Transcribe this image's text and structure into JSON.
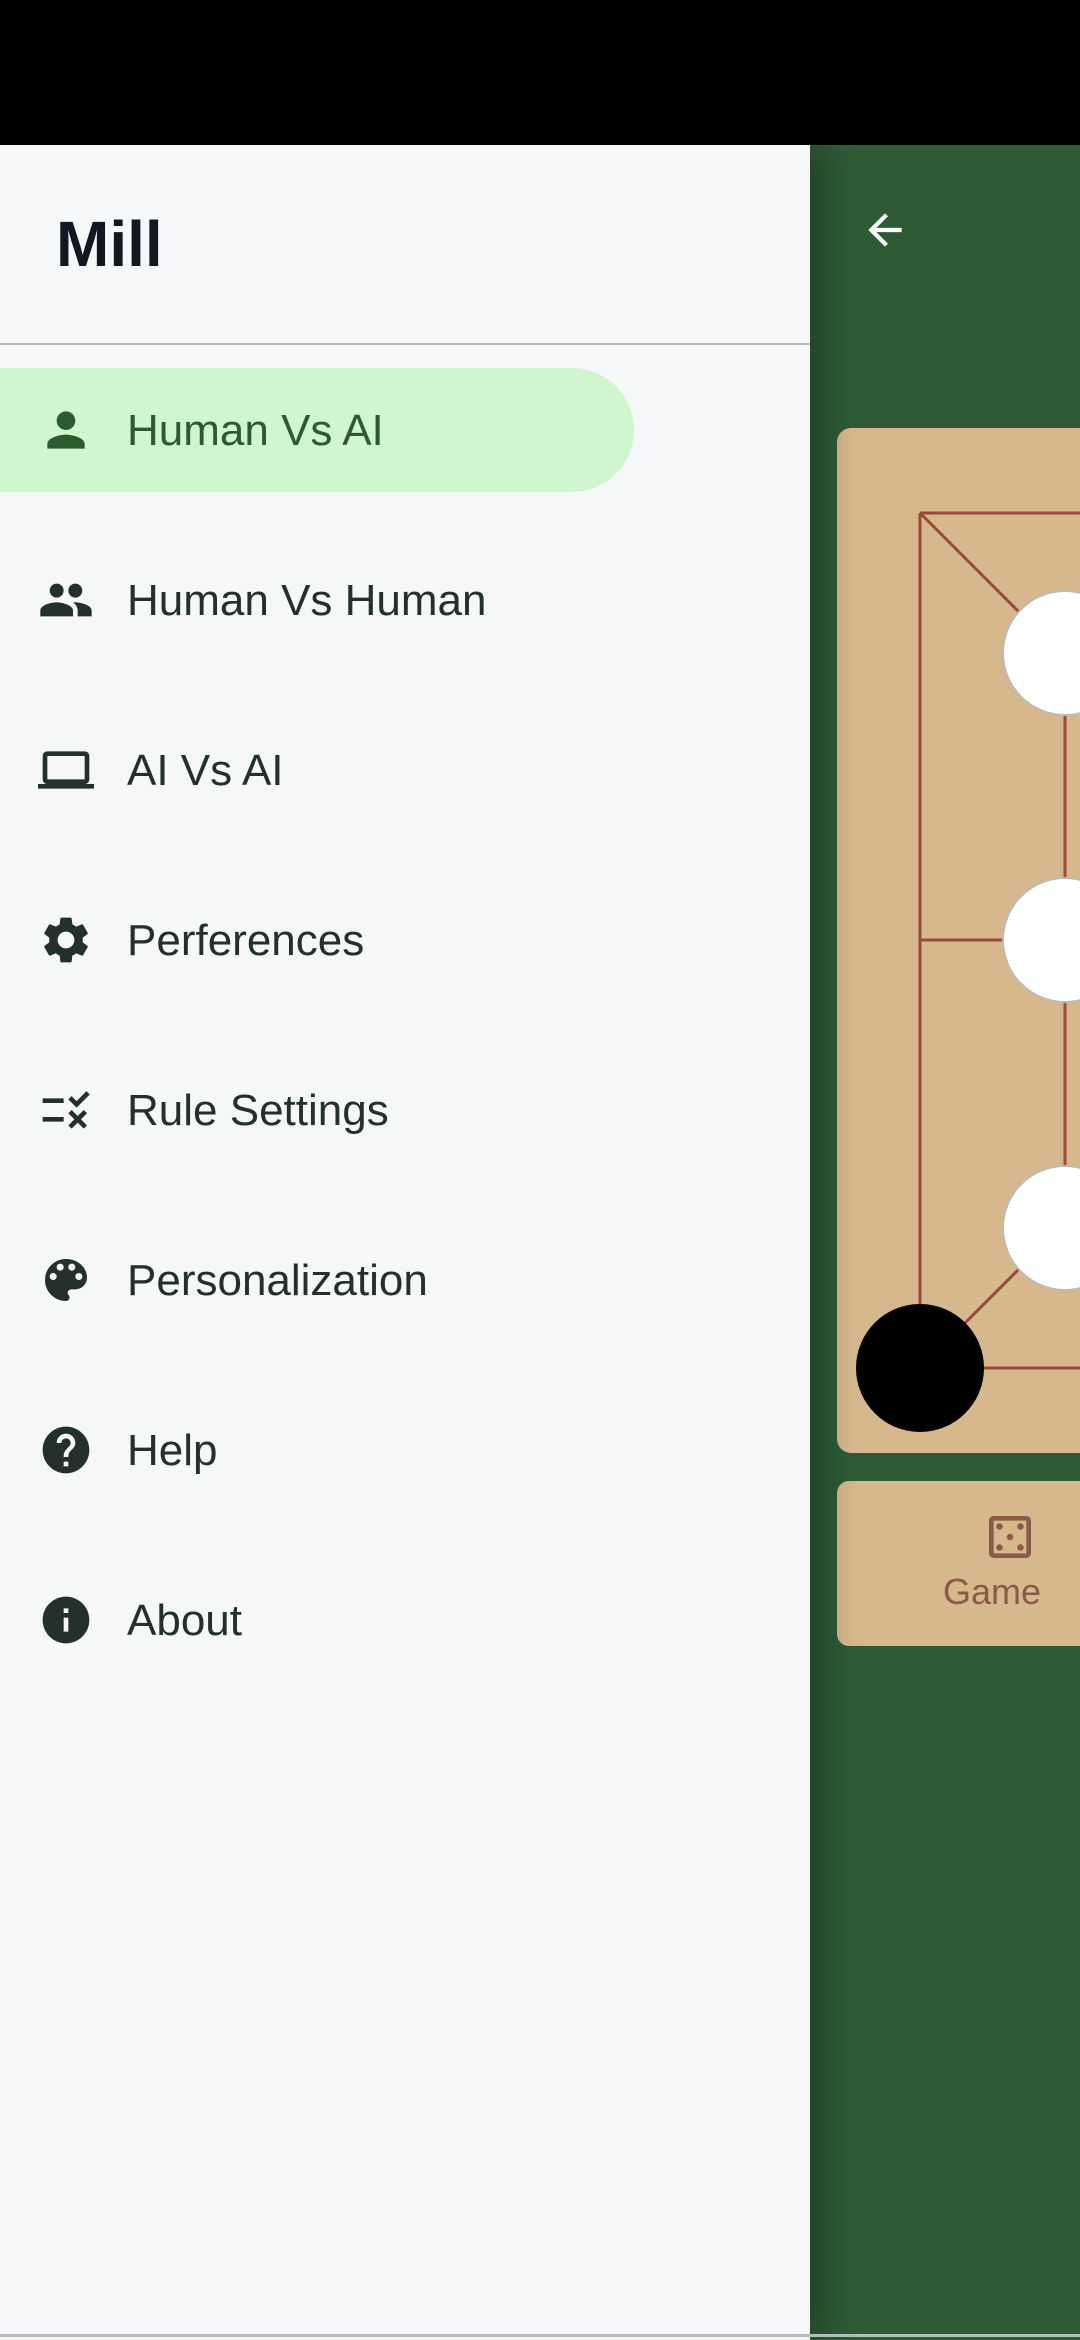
{
  "drawer": {
    "title": "Mill",
    "items": [
      {
        "label": "Human Vs AI",
        "icon": "person-icon",
        "active": true
      },
      {
        "label": "Human Vs Human",
        "icon": "people-icon",
        "active": false
      },
      {
        "label": "AI Vs AI",
        "icon": "laptop-icon",
        "active": false
      },
      {
        "label": "Perferences",
        "icon": "gear-icon",
        "active": false
      },
      {
        "label": "Rule Settings",
        "icon": "rule-icon",
        "active": false
      },
      {
        "label": "Personalization",
        "icon": "palette-icon",
        "active": false
      },
      {
        "label": "Help",
        "icon": "help-icon",
        "active": false
      },
      {
        "label": "About",
        "icon": "info-icon",
        "active": false
      }
    ]
  },
  "game": {
    "back_icon": "arrow-back-icon",
    "toolbar": {
      "label": "Game",
      "icon": "dice-icon"
    }
  },
  "colors": {
    "background": "#2e5b36",
    "board": "#d7b88c",
    "board_lines": "#9a4a3c",
    "drawer": "#f5f7f9",
    "active_item": "#d1f5cf",
    "active_text": "#2d5a2e"
  }
}
